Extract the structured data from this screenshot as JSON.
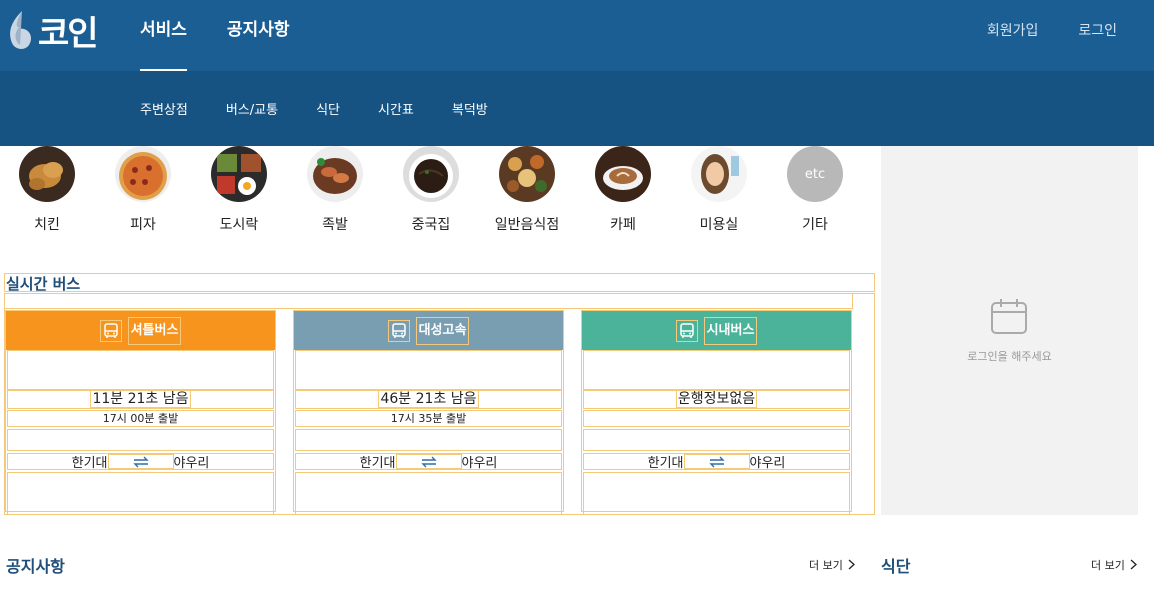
{
  "header": {
    "logo_text": "코인",
    "nav": [
      "서비스",
      "공지사항"
    ],
    "user_nav": [
      "회원가입",
      "로그인"
    ],
    "sub_nav": [
      "주변상점",
      "버스/교통",
      "식단",
      "시간표",
      "복덕방"
    ]
  },
  "categories": [
    "치킨",
    "피자",
    "도시락",
    "족발",
    "중국집",
    "일반음식점",
    "카페",
    "미용실",
    "기타"
  ],
  "etc_label": "etc",
  "bus": {
    "title": "실시간 버스",
    "cards": [
      {
        "name": "셔틀버스",
        "time": "11분 21초 남음",
        "depart": "17시 00분 출발",
        "from": "한기대",
        "to": "야우리",
        "color": "#f7941d"
      },
      {
        "name": "대성고속",
        "time": "46분 21초 남음",
        "depart": "17시 35분 출발",
        "from": "한기대",
        "to": "야우리",
        "color": "#7a9eb1"
      },
      {
        "name": "시내버스",
        "time": "운행정보없음",
        "depart": "",
        "from": "한기대",
        "to": "야우리",
        "color": "#4bb39a"
      }
    ]
  },
  "side": {
    "login_msg": "로그인을 해주세요"
  },
  "notice": {
    "title": "공지사항",
    "more": "더 보기"
  },
  "meal": {
    "title": "식단",
    "more": "더 보기"
  }
}
